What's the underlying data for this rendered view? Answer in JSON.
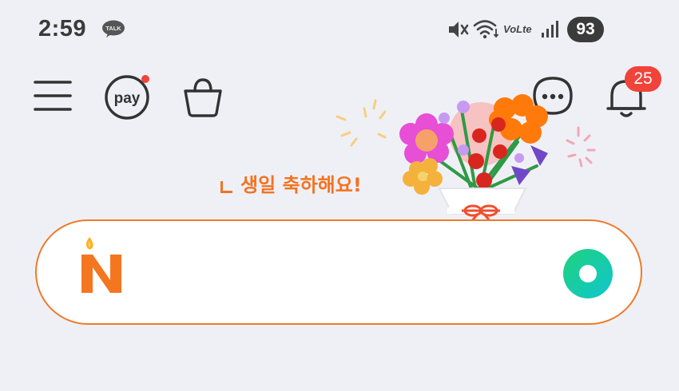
{
  "status_bar": {
    "time": "2:59",
    "talk_badge": "TALK",
    "network_label": "VoLte",
    "battery": "93"
  },
  "toolbar": {
    "menu_icon": "hamburger-menu-icon",
    "pay_label": "pay",
    "shopping_icon": "shopping-bag-icon",
    "chat_icon": "chat-bubble-icon",
    "bell_icon": "bell-icon",
    "notification_count": "25"
  },
  "banner": {
    "greeting": "생일 축하해요!"
  },
  "search": {
    "placeholder": "",
    "logo_letter": "N"
  },
  "colors": {
    "background": "#eff0f6",
    "accent_orange": "#f27321",
    "badge_red": "#f0433a",
    "green_gradient_start": "#1fd27c",
    "green_gradient_end": "#10c6cf"
  }
}
